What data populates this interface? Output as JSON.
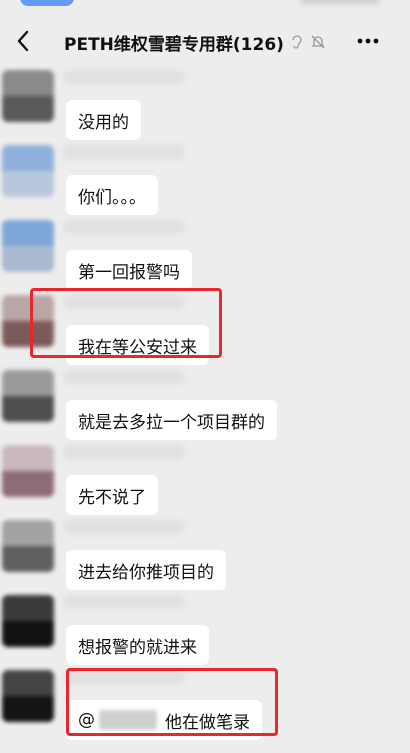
{
  "header": {
    "title": "PETH维权雪碧专用群(126)",
    "back_icon": "chevron-left-icon",
    "more_icon": "ellipsis-icon"
  },
  "messages": [
    {
      "text": "没用的"
    },
    {
      "text": "你们。。。"
    },
    {
      "text": "第一回报警吗"
    },
    {
      "text": "我在等公安过来",
      "highlighted": true
    },
    {
      "text": "就是去多拉一个项目群的"
    },
    {
      "text": "先不说了"
    },
    {
      "text": "进去给你推项目的"
    },
    {
      "text": "想报警的就进来"
    },
    {
      "mention": "@",
      "text": "他在做笔录",
      "highlighted": true
    }
  ],
  "colors": {
    "background": "#ededed",
    "bubble": "#ffffff",
    "highlight": "#e8262b"
  }
}
